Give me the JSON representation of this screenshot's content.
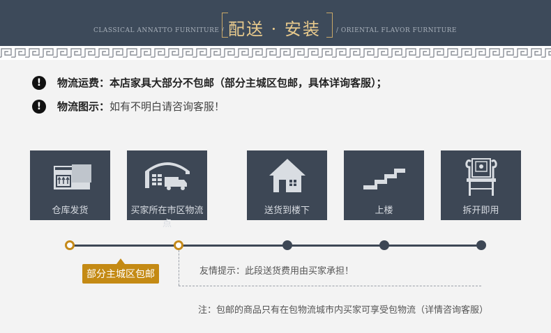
{
  "banner": {
    "title": "配送 · 安装",
    "subtitle_left": "CLASSICAL ANNATTO FURNITURE /",
    "subtitle_right": "/ ORIENTAL FLAVOR FURNITURE"
  },
  "info": {
    "fee_label": "物流运费：",
    "fee_text": "本店家具大部分不包邮（部分主城区包邮，具体详询客服）；",
    "diagram_label": "物流图示：",
    "diagram_text": "如有不明白请咨询客服！"
  },
  "steps": [
    {
      "label": "仓库发货",
      "icon": "warehouse-box-icon"
    },
    {
      "label": "买家所在市区物流点",
      "icon": "logistics-depot-truck-icon"
    },
    {
      "label": "送货到楼下",
      "icon": "house-icon"
    },
    {
      "label": "上楼",
      "icon": "stairs-icon"
    },
    {
      "label": "拆开即用",
      "icon": "chair-icon"
    }
  ],
  "timeline": {
    "badge": "部分主城区包邮",
    "tip": "友情提示：此段送货费用由买家承担！",
    "note": "注：包邮的商品只有在包物流城市内买家可享受包物流（详情咨询客服）"
  },
  "colors": {
    "banner_bg": "#3d4a5a",
    "title_gold": "#e7c98c",
    "card_bg": "#3d4755",
    "accent_orange": "#c48a14"
  }
}
